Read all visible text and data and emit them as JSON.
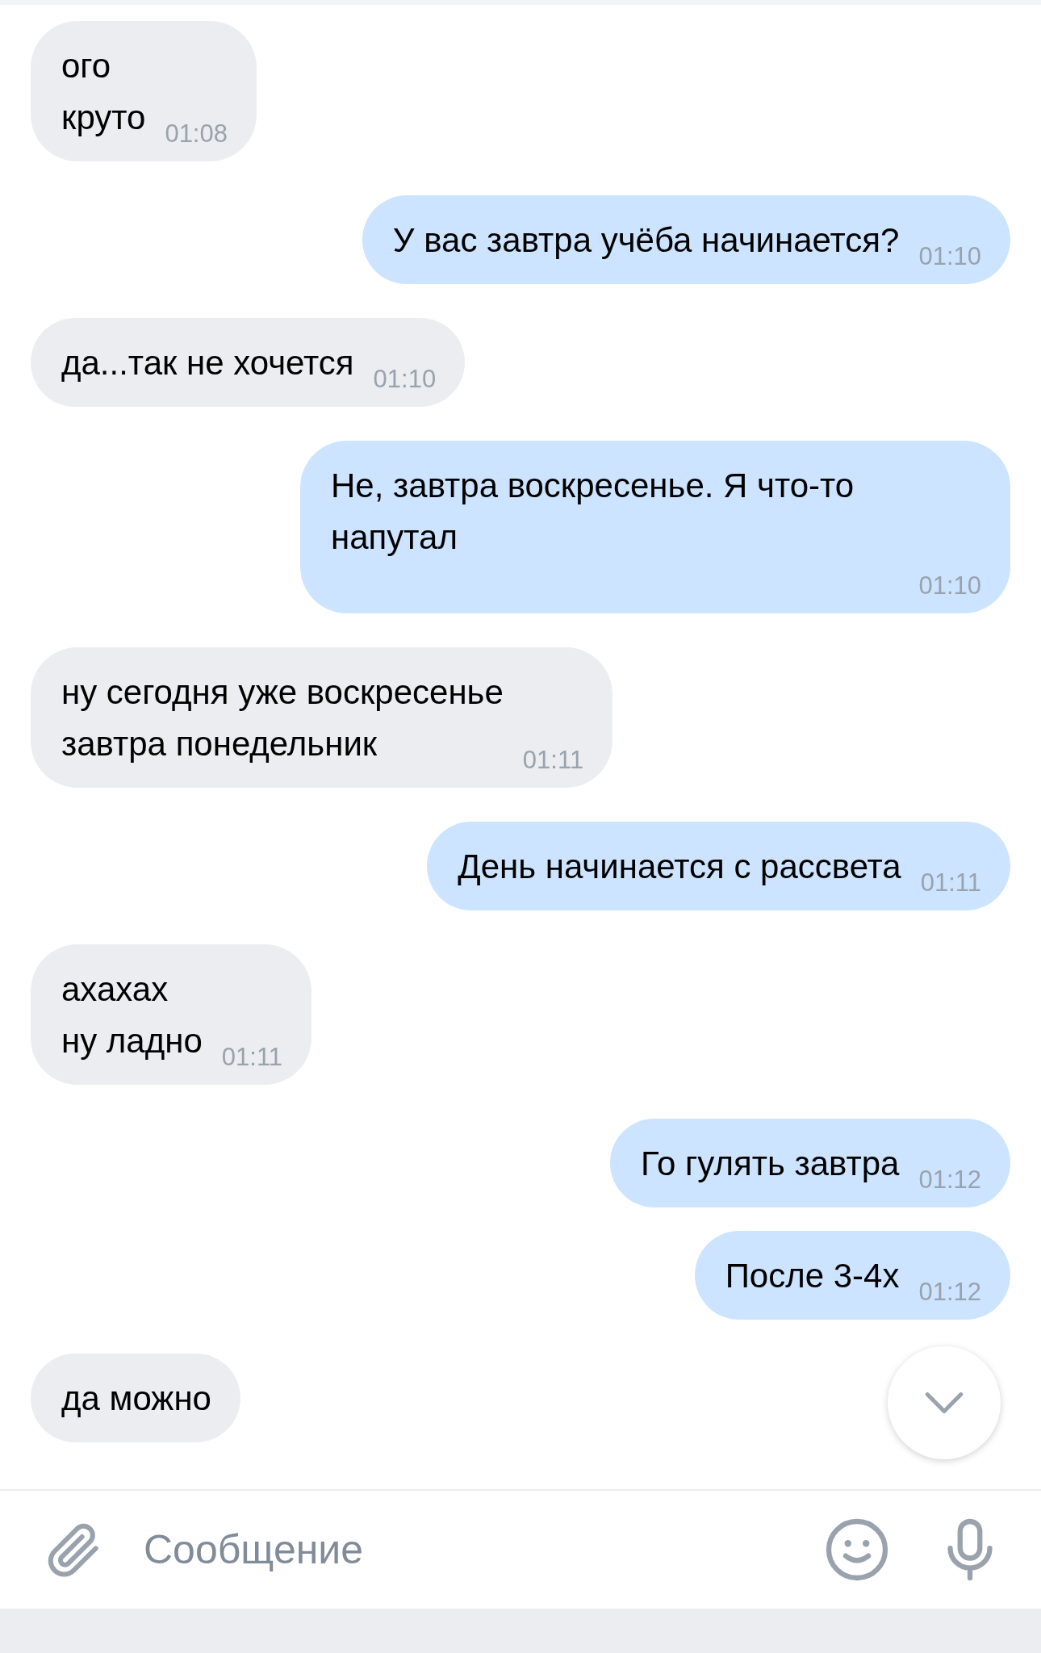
{
  "messages": [
    {
      "kind": "in",
      "text": "ого\nкруто",
      "time": "01:08"
    },
    {
      "kind": "out",
      "text": "У вас завтра учёба начинается?",
      "time": "01:10"
    },
    {
      "kind": "in",
      "text": "да...так не хочется",
      "time": "01:10"
    },
    {
      "kind": "out",
      "text": "Не, завтра воскресенье. Я что-то напутал",
      "time": "01:10"
    },
    {
      "kind": "in",
      "text": "ну сегодня уже воскресенье\nзавтра понедельник",
      "time": "01:11"
    },
    {
      "kind": "out",
      "text": "День начинается с рассвета",
      "time": "01:11"
    },
    {
      "kind": "in",
      "text": "ахахах\nну ладно",
      "time": "01:11"
    },
    {
      "kind": "out",
      "text": "Го гулять завтра",
      "time": "01:12"
    },
    {
      "kind": "out",
      "text": "После 3-4х",
      "time": "01:12"
    },
    {
      "kind": "in",
      "text": "да можно"
    }
  ],
  "composer": {
    "placeholder": "Сообщение"
  }
}
